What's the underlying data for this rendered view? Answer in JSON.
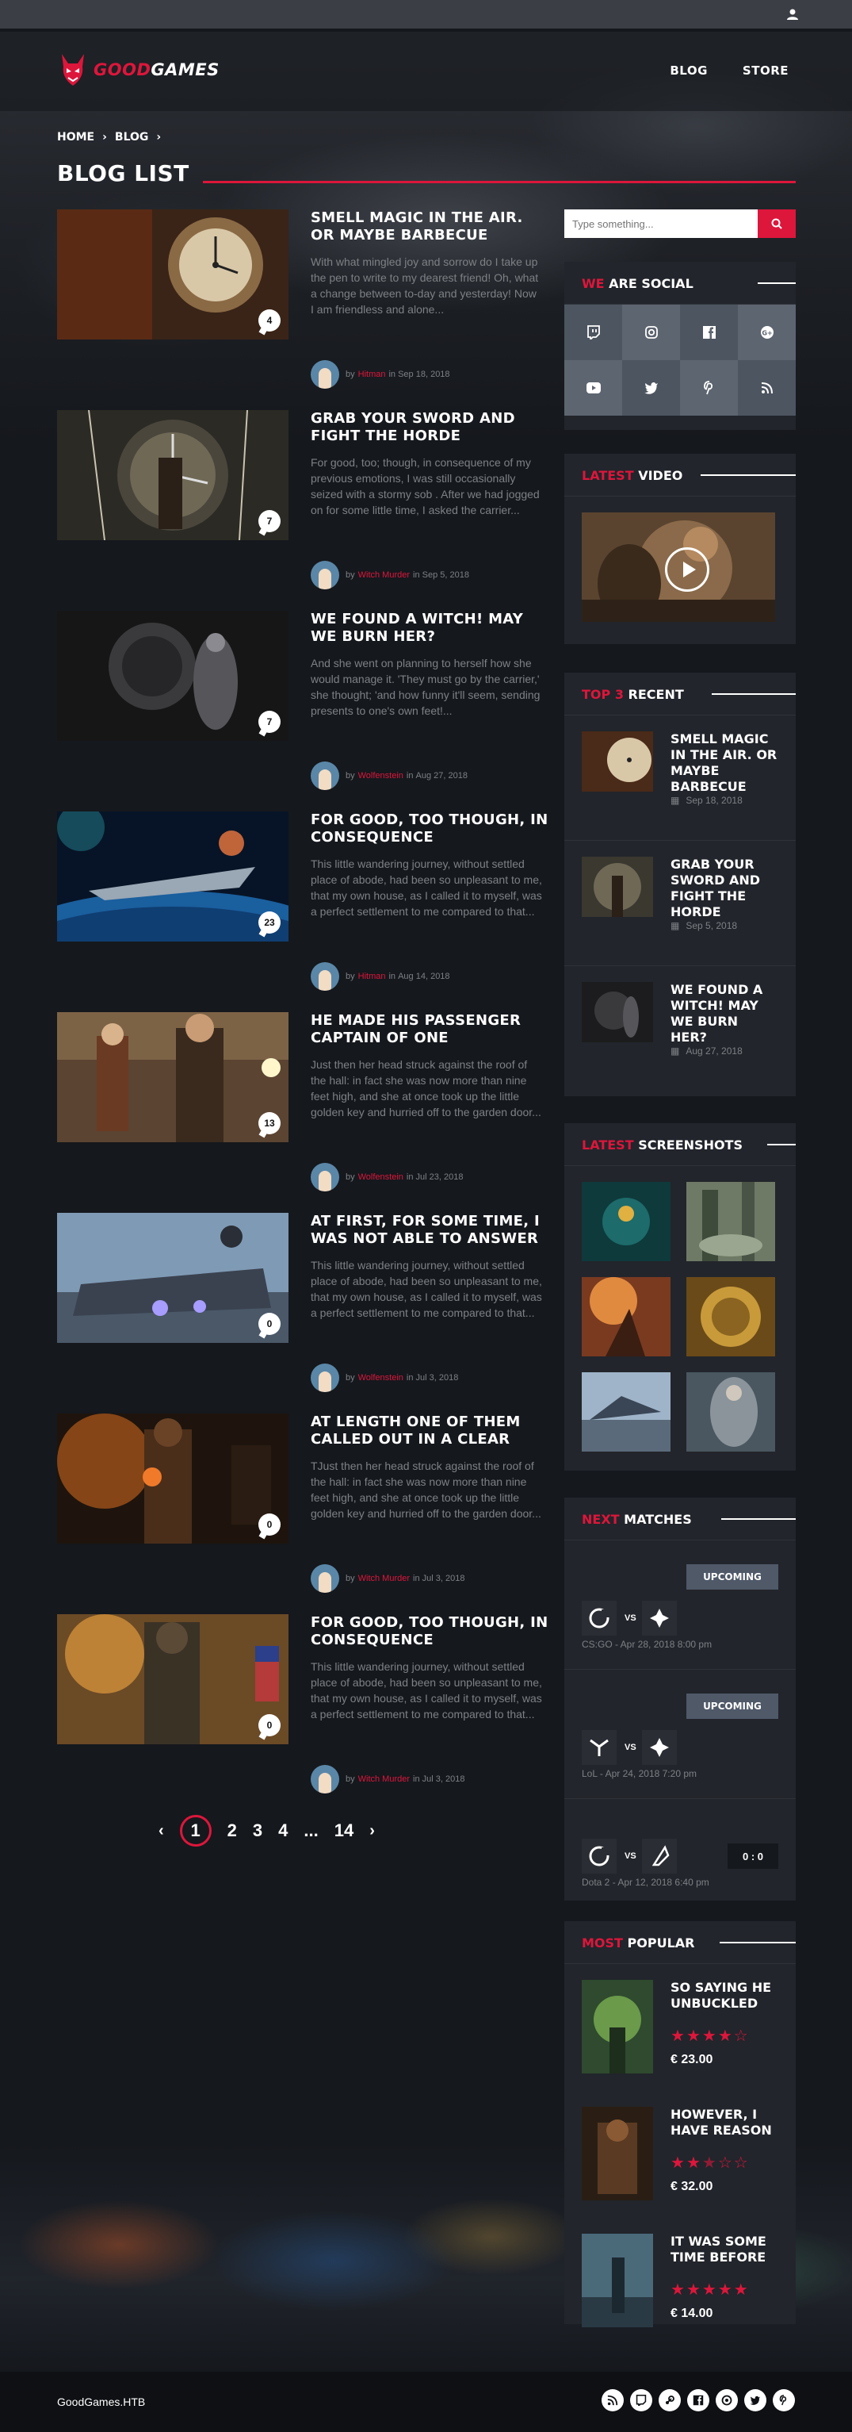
{
  "header": {
    "logo_good": "GOOD",
    "logo_games": "GAMES",
    "nav": [
      "BLOG",
      "STORE"
    ]
  },
  "breadcrumb": [
    "HOME",
    "BLOG"
  ],
  "page_title": "BLOG LIST",
  "posts": [
    {
      "title": "SMELL MAGIC IN THE AIR. OR MAYBE BARBECUE",
      "excerpt": "With what mingled joy and sorrow do I take up the pen to write to my dearest friend! Oh, what a change between to-day and yesterday! Now I am friendless and alone...",
      "comments": "4",
      "author": "Hitman",
      "date": "Sep 18, 2018"
    },
    {
      "title": "GRAB YOUR SWORD AND FIGHT THE HORDE",
      "excerpt": "For good, too; though, in consequence of my previous emotions, I was still occasionally seized with a stormy sob . After we had jogged on for some little time, I asked the carrier...",
      "comments": "7",
      "author": "Witch Murder",
      "date": "Sep 5, 2018"
    },
    {
      "title": "WE FOUND A WITCH! MAY WE BURN HER?",
      "excerpt": "And she went on planning to herself how she would manage it. 'They must go by the carrier,' she thought; 'and how funny it'll seem, sending presents to one's own feet!...",
      "comments": "7",
      "author": "Wolfenstein",
      "date": "Aug 27, 2018"
    },
    {
      "title": "FOR GOOD, TOO THOUGH, IN CONSEQUENCE",
      "excerpt": "This little wandering journey, without settled place of abode, had been so unpleasant to me, that my own house, as I called it to myself, was a perfect settlement to me compared to that...",
      "comments": "23",
      "author": "Hitman",
      "date": "Aug 14, 2018"
    },
    {
      "title": "HE MADE HIS PASSENGER CAPTAIN OF ONE",
      "excerpt": "Just then her head struck against the roof of the hall: in fact she was now more than nine feet high, and she at once took up the little golden key and hurried off to the garden door...",
      "comments": "13",
      "author": "Wolfenstein",
      "date": "Jul 23, 2018"
    },
    {
      "title": "AT FIRST, FOR SOME TIME, I WAS NOT ABLE TO ANSWER",
      "excerpt": "This little wandering journey, without settled place of abode, had been so unpleasant to me, that my own house, as I called it to myself, was a perfect settlement to me compared to that...",
      "comments": "0",
      "author": "Wolfenstein",
      "date": "Jul 3, 2018"
    },
    {
      "title": "AT LENGTH ONE OF THEM CALLED OUT IN A CLEAR",
      "excerpt": "TJust then her head struck against the roof of the hall: in fact she was now more than nine feet high, and she at once took up the little golden key and hurried off to the garden door...",
      "comments": "0",
      "author": "Witch Murder",
      "date": "Jul 3, 2018"
    },
    {
      "title": "FOR GOOD, TOO THOUGH, IN CONSEQUENCE",
      "excerpt": "This little wandering journey, without settled place of abode, had been so unpleasant to me, that my own house, as I called it to myself, was a perfect settlement to me compared to that...",
      "comments": "0",
      "author": "Witch Murder",
      "date": "Jul 3, 2018"
    }
  ],
  "meta_by": "by",
  "meta_in": "in",
  "pagination": {
    "pages": [
      "1",
      "2",
      "3",
      "4",
      "...",
      "14"
    ],
    "current": "1"
  },
  "search": {
    "placeholder": "Type something..."
  },
  "social": {
    "title_accent": "WE",
    "title_rest": "ARE SOCIAL",
    "icons": [
      "twitch-icon",
      "instagram-icon",
      "facebook-icon",
      "google-plus-icon",
      "youtube-icon",
      "twitter-icon",
      "pinterest-icon",
      "rss-icon"
    ]
  },
  "latest_video": {
    "title_accent": "LATEST",
    "title_rest": "VIDEO"
  },
  "top3": {
    "title_accent": "TOP 3",
    "title_rest": "RECENT",
    "items": [
      {
        "title": "SMELL MAGIC IN THE AIR. OR MAYBE BARBECUE",
        "date": "Sep 18, 2018"
      },
      {
        "title": "GRAB YOUR SWORD AND FIGHT THE HORDE",
        "date": "Sep 5, 2018"
      },
      {
        "title": "WE FOUND A WITCH! MAY WE BURN HER?",
        "date": "Aug 27, 2018"
      }
    ]
  },
  "screenshots": {
    "title_accent": "LATEST",
    "title_rest": "SCREENSHOTS"
  },
  "matches": {
    "title_accent": "NEXT",
    "title_rest": "MATCHES",
    "vs": "VS",
    "items": [
      {
        "status": "UPCOMING",
        "info": "CS:GO - Apr 28, 2018 8:00 pm"
      },
      {
        "status": "UPCOMING",
        "info": "LoL - Apr 24, 2018 7:20 pm"
      },
      {
        "score": "0 : 0",
        "info": "Dota 2 - Apr 12, 2018 6:40 pm"
      }
    ]
  },
  "popular": {
    "title_accent": "MOST",
    "title_rest": "POPULAR",
    "items": [
      {
        "title": "SO SAYING HE UNBUCKLED",
        "rating": 4,
        "price": "€ 23.00"
      },
      {
        "title": "HOWEVER, I HAVE REASON",
        "rating": 2.5,
        "price": "€ 32.00"
      },
      {
        "title": "IT WAS SOME TIME BEFORE",
        "rating": 5,
        "price": "€ 14.00"
      }
    ]
  },
  "footer": {
    "brand": "GoodGames.HTB",
    "icons": [
      "rss-icon",
      "twitch-icon",
      "steam-icon",
      "facebook-icon",
      "dribbble-icon",
      "twitter-icon",
      "pinterest-icon"
    ]
  },
  "colors": {
    "accent": "#dd163b",
    "background": "#15181d",
    "panel": "#22252b"
  }
}
